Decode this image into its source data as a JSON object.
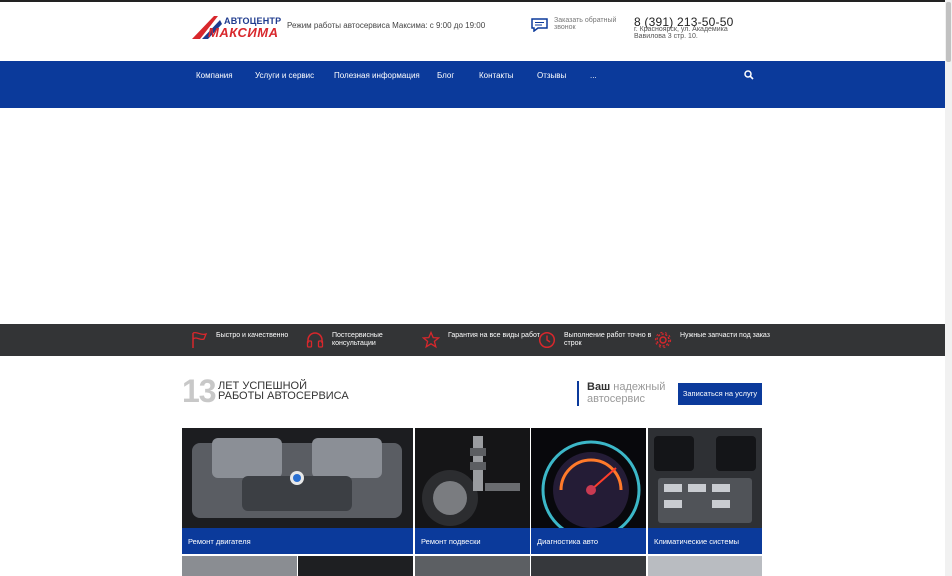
{
  "header": {
    "logo_top": "АВТОЦЕНТР",
    "logo_bottom": "МАКСИМА",
    "hours": "Режим работы автосервиса Максима: с 9:00 до 19:00",
    "callback": "Заказать обратный звонок",
    "phone": "8 (391) 213-50-50",
    "address": "г. Красноярск, ул. Академика Вавилова 3 стр. 10."
  },
  "nav": {
    "items": [
      "Компания",
      "Услуги и сервис",
      "Полезная информация",
      "Блог",
      "Контакты",
      "Отзывы",
      "..."
    ]
  },
  "features": [
    {
      "icon": "flag-icon",
      "text": "Быстро и качественно"
    },
    {
      "icon": "headphones-icon",
      "text": "Постсервисные консультации"
    },
    {
      "icon": "star-icon",
      "text": "Гарантия на все виды работ"
    },
    {
      "icon": "clock-icon",
      "text": "Выполнение работ точно в строк"
    },
    {
      "icon": "gear-icon",
      "text": "Нужные запчасти под заказ"
    }
  ],
  "promo": {
    "years_number": "13",
    "years_text_1": "лет успешной",
    "years_text_2": "работы автосервиса",
    "reliable_bold": "Ваш",
    "reliable_rest": "надежный автосервис",
    "signup_button": "Записаться на услугу"
  },
  "services": [
    {
      "label": "Ремонт двигателя"
    },
    {
      "label": "Ремонт подвески"
    },
    {
      "label": "Диагностика авто"
    },
    {
      "label": "Климатические системы"
    }
  ],
  "colors": {
    "brand_blue": "#0b3a9b",
    "brand_red": "#d8272c",
    "feature_icon_red": "#d8272c",
    "features_bg": "#333436"
  }
}
